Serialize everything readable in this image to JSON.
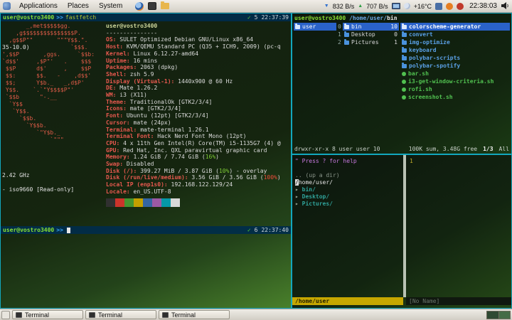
{
  "top_panel": {
    "menus": [
      "Applications",
      "Places",
      "System"
    ],
    "net_down_icon": "▼",
    "net_down_label": "832 B/s",
    "net_up_icon": "▲",
    "net_up_label": "707 B/s",
    "temperature": "+16°C",
    "clock": "22:38:03"
  },
  "left_terminal": {
    "prompt_top": {
      "user": "user@vostro3400",
      "arrow": ">>",
      "command": "fastfetch",
      "ok": "✓",
      "num": "5",
      "time": "22:37:39"
    },
    "prompt_bottom": {
      "user": "user@vostro3400",
      "arrow": ">>",
      "ok": "✓",
      "num": "6",
      "time": "22:37:40"
    },
    "ascii_art": [
      {
        "r": "       _,met$$$$$gg."
      },
      {
        "r": "    ,g$$$$$$$$$$$$$$$P."
      },
      {
        "r": "  ,g$$P\"\"       \"\"\"Y$$.\"."
      },
      {
        "w": "35-10.0)",
        "r": "            `$$$."
      },
      {
        "r": "',$$P       ,ggs.     `$$b:"
      },
      {
        "r": "`d$$'     ,$P\"'   .    $$$"
      },
      {
        "r": " $$P      d$'     ,    $$P"
      },
      {
        "r": " $$:      $$.   -    ,d$$'"
      },
      {
        "r": " $$;      Y$b._   _,d$P'"
      },
      {
        "r": " Y$$.    `.`\"Y$$$$P\"'"
      },
      {
        "r": " `$$b      \"-.__"
      },
      {
        "r": "  `Y$$"
      },
      {
        "r": "   `Y$$."
      },
      {
        "r": "     `$$b."
      },
      {
        "r": "       `Y$$b."
      },
      {
        "r": "          `\"Y$b._"
      },
      {
        "r": "              `\"\"\""
      },
      {
        "r": ""
      },
      {
        "r": ""
      },
      {
        "r": ""
      },
      {
        "r": ""
      },
      {
        "w": "2.42 GHz",
        "r": ""
      },
      {
        "r": ""
      },
      {
        "w": "- iso9660 [Read-only]",
        "r": ""
      }
    ],
    "fastfetch": {
      "title": "user@vostro3400",
      "separator": "---------------",
      "lines": [
        {
          "k": "OS",
          "v": "SULET Optimized Debian GNU/Linux x86_64"
        },
        {
          "k": "Host",
          "v": "KVM/QEMU Standard PC (Q35 + ICH9, 2009) (pc-q"
        },
        {
          "k": "Kernel",
          "v": "Linux 6.12.27-amd64"
        },
        {
          "k": "Uptime",
          "v": "16 mins"
        },
        {
          "k": "Packages",
          "v": "2063 (dpkg)"
        },
        {
          "k": "Shell",
          "v": "zsh 5.9"
        },
        {
          "k": "Display (Virtual-1)",
          "v": "1440x900 @ 60 Hz"
        },
        {
          "k": "DE",
          "v": "Mate 1.26.2"
        },
        {
          "k": "WM",
          "v": "i3 (X11)"
        },
        {
          "k": "Theme",
          "v": "TraditionalOk [GTK2/3/4]"
        },
        {
          "k": "Icons",
          "v": "mate [GTK2/3/4]"
        },
        {
          "k": "Font",
          "v": "Ubuntu (12pt) [GTK2/3/4]"
        },
        {
          "k": "Cursor",
          "v": "mate (24px)"
        },
        {
          "k": "Terminal",
          "v": "mate-terminal 1.26.1"
        },
        {
          "k": "Terminal Font",
          "v": "Hack Nerd Font Mono (12pt)"
        },
        {
          "k": "CPU",
          "v": "4 x 11th Gen Intel(R) Core(TM) i5-1135G7 (4) @"
        },
        {
          "k": "GPU",
          "v": "Red Hat, Inc. QXL paravirtual graphic card"
        },
        {
          "k": "Memory",
          "v": [
            [
              "1.24 GiB / 7.74 GiB (",
              "fg"
            ],
            [
              "16%",
              "green"
            ],
            [
              ")",
              "fg"
            ]
          ]
        },
        {
          "k": "Swap",
          "v": "Disabled"
        },
        {
          "k": "Disk (/)",
          "v": [
            [
              "399.27 MiB / 3.87 GiB (",
              "fg"
            ],
            [
              "10%",
              "green"
            ],
            [
              ") - overlay",
              "fg"
            ]
          ]
        },
        {
          "k": "Disk (/run/live/medium)",
          "v": [
            [
              "3.56 GiB / 3.56 GiB (",
              "fg"
            ],
            [
              "100%",
              "red"
            ],
            [
              ")",
              "fg"
            ]
          ]
        },
        {
          "k": "Local IP (enp1s0)",
          "v": "192.168.122.129/24"
        },
        {
          "k": "Locale",
          "v": "en_US.UTF-8"
        }
      ],
      "palette": [
        "#303030",
        "#cc342b",
        "#459430",
        "#c4a000",
        "#3465a4",
        "#9c59a5",
        "#0598a8",
        "#d8d8d8"
      ]
    }
  },
  "ranger": {
    "title": {
      "user": "user@vostro3400",
      "path": "/home/user/",
      "current": "bin"
    },
    "parent_col": [
      {
        "name": "user",
        "selected": true
      }
    ],
    "main_col": [
      {
        "num": "0",
        "name": "bin",
        "count": "10",
        "selected": true
      },
      {
        "num": "1",
        "name": "Desktop",
        "count": "0"
      },
      {
        "num": "2",
        "name": "Pictures",
        "count": "1"
      }
    ],
    "preview_col": [
      {
        "name": "colorscheme-generator",
        "type": "dir",
        "selected": true
      },
      {
        "name": "convert",
        "type": "dir"
      },
      {
        "name": "img-optimize",
        "type": "dir"
      },
      {
        "name": "keyboard",
        "type": "dir"
      },
      {
        "name": "polybar-scripts",
        "type": "dir"
      },
      {
        "name": "polybar-spotify",
        "type": "dir"
      },
      {
        "name": "bar.sh",
        "type": "script"
      },
      {
        "name": "i3-get-window-criteria.sh",
        "type": "script"
      },
      {
        "name": "rofi.sh",
        "type": "script"
      },
      {
        "name": "screenshot.sh",
        "type": "script"
      }
    ],
    "status_left": "drwxr-xr-x 8 user user 10",
    "status_right": "100K sum, 3.48G free",
    "status_pos": "1/3",
    "status_filter": "All"
  },
  "vim": {
    "help_line": "\" Press ? for help",
    "up_dir": ".. (up a dir)",
    "root": "/home/user/",
    "tree_arrow": "▸ ",
    "tree": [
      "bin/",
      "Desktop/",
      "Pictures/"
    ],
    "statusline_left": "/home/user",
    "statusline_right": "[No Name]",
    "line_number": "1"
  },
  "taskbar": {
    "buttons": [
      "Terminal",
      "Terminal",
      "Terminal"
    ]
  }
}
